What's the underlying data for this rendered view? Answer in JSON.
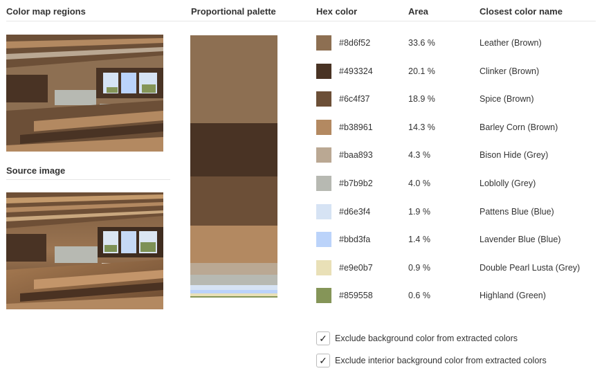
{
  "headings": {
    "color_map_regions": "Color map regions",
    "proportional_palette": "Proportional palette",
    "hex_color": "Hex color",
    "area": "Area",
    "closest_color_name": "Closest color name",
    "source_image": "Source image"
  },
  "colors": [
    {
      "hex": "#8d6f52",
      "area": "33.6 %",
      "area_value": 33.6,
      "name": "Leather (Brown)"
    },
    {
      "hex": "#493324",
      "area": "20.1 %",
      "area_value": 20.1,
      "name": "Clinker (Brown)"
    },
    {
      "hex": "#6c4f37",
      "area": "18.9 %",
      "area_value": 18.9,
      "name": "Spice (Brown)"
    },
    {
      "hex": "#b38961",
      "area": "14.3 %",
      "area_value": 14.3,
      "name": "Barley Corn (Brown)"
    },
    {
      "hex": "#baa893",
      "area": "4.3 %",
      "area_value": 4.3,
      "name": "Bison Hide (Grey)"
    },
    {
      "hex": "#b7b9b2",
      "area": "4.0 %",
      "area_value": 4.0,
      "name": "Loblolly (Grey)"
    },
    {
      "hex": "#d6e3f4",
      "area": "1.9 %",
      "area_value": 1.9,
      "name": "Pattens Blue (Blue)"
    },
    {
      "hex": "#bbd3fa",
      "area": "1.4 %",
      "area_value": 1.4,
      "name": "Lavender Blue (Blue)"
    },
    {
      "hex": "#e9e0b7",
      "area": "0.9 %",
      "area_value": 0.9,
      "name": "Double Pearl Lusta (Grey)"
    },
    {
      "hex": "#859558",
      "area": "0.6 %",
      "area_value": 0.6,
      "name": "Highland (Green)"
    }
  ],
  "options": [
    {
      "label": "Exclude background color from extracted colors",
      "checked": true
    },
    {
      "label": "Exclude interior background color from extracted colors",
      "checked": true
    }
  ]
}
